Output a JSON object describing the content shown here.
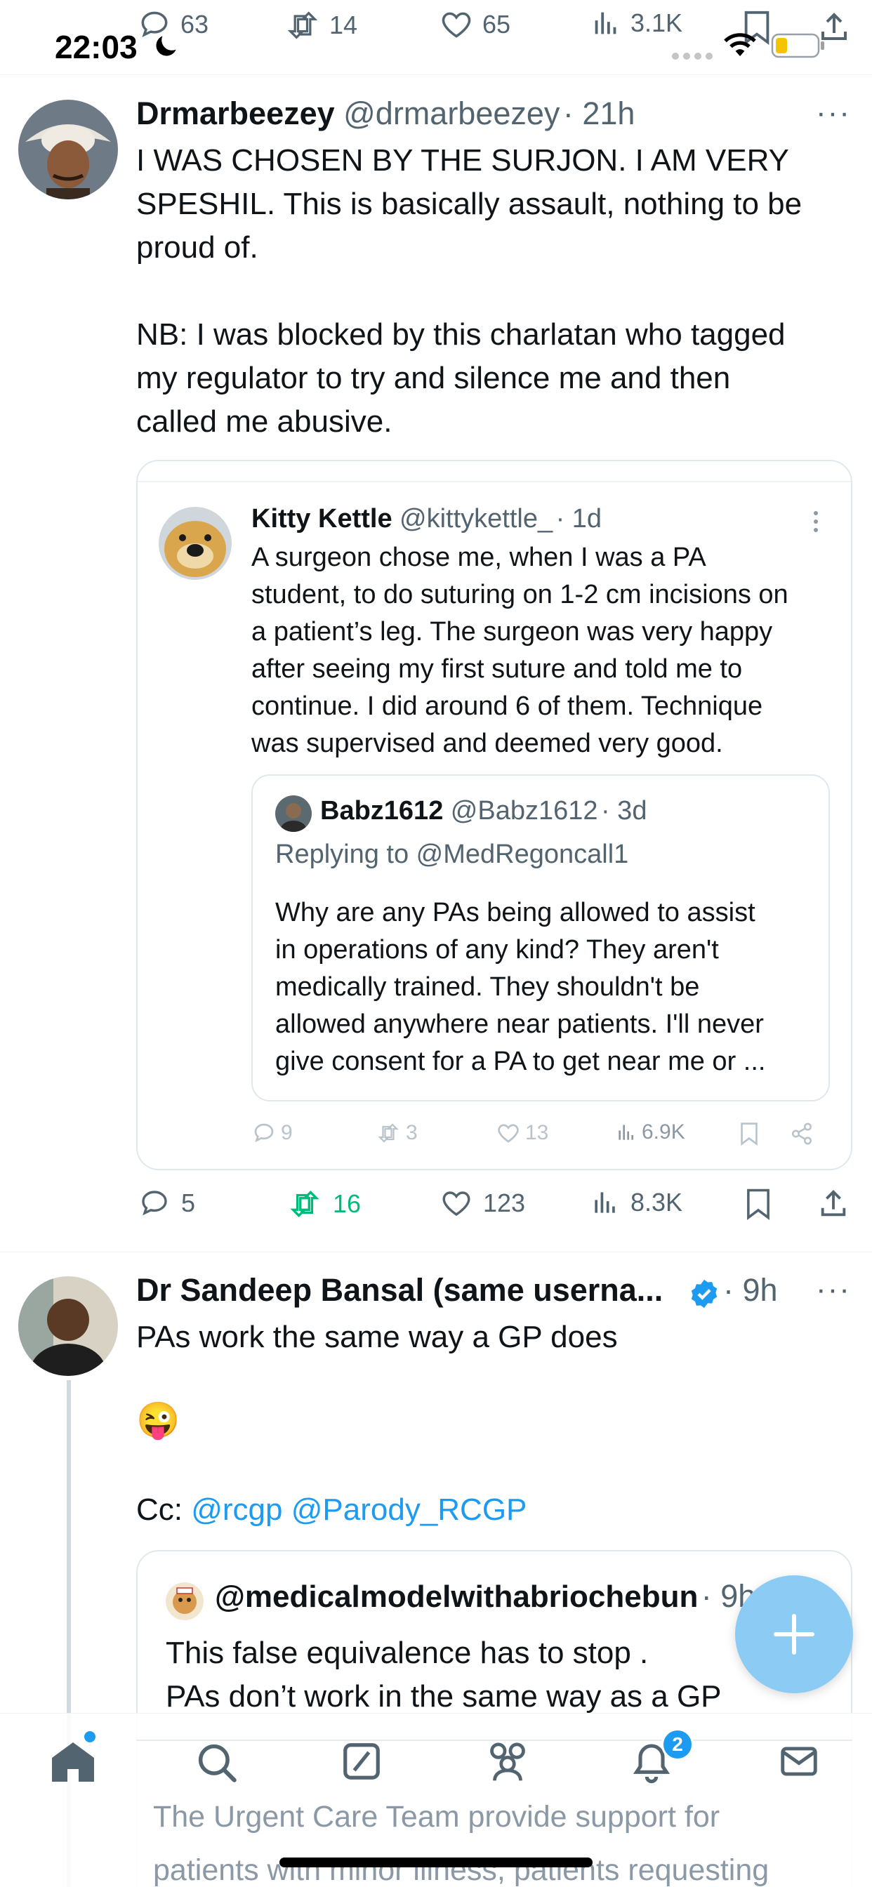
{
  "status_bar": {
    "time": "22:03"
  },
  "top_actions": {
    "replies": "63",
    "reposts": "14",
    "likes": "65",
    "views": "3.1K"
  },
  "tweet1": {
    "display_name": "Drmarbeezey",
    "handle": "@drmarbeezey",
    "time": "· 21h",
    "more": "···",
    "text_lines": [
      "I WAS CHOSEN BY THE SURJON. I AM VERY",
      "SPESHIL. This is basically assault, nothing to be",
      "proud of.",
      "NB: I was blocked by this charlatan who tagged",
      "my regulator to try and silence me and then",
      "called me abusive."
    ],
    "quote": {
      "display_name": "Kitty Kettle",
      "handle": "@kittykettle_",
      "time": "· 1d",
      "text_lines": [
        "A surgeon chose me, when I was a PA",
        "student, to do suturing on 1-2 cm incisions on",
        "a patient’s leg. The surgeon was very happy",
        "after seeing my first suture and told me to",
        "continue. I did around 6 of them. Technique",
        "was supervised and deemed very good."
      ],
      "nested": {
        "display_name": "Babz1612",
        "handle": "@Babz1612",
        "time": "· 3d",
        "replying": "Replying to @MedRegoncall1",
        "text_lines": [
          "Why are any PAs being allowed to assist",
          "in operations of any kind? They aren't",
          "medically trained. They shouldn't be",
          "allowed anywhere near patients. I'll never",
          "give consent for a PA to get near me or ..."
        ]
      },
      "stats": {
        "replies": "9",
        "reposts": "3",
        "likes": "13",
        "views": "6.9K"
      }
    },
    "stats": {
      "replies": "5",
      "reposts": "16",
      "likes": "123",
      "views": "8.3K"
    }
  },
  "tweet2": {
    "display_name": "Dr Sandeep Bansal (same userna...",
    "time": "· 9h",
    "more": "···",
    "line1": "PAs work the same way a GP does",
    "emoji": "😜",
    "cc_label": "Cc: ",
    "mention1": "@rcgp",
    "mention2": "@Parody_RCGP",
    "quote": {
      "handle": "@medicalmodelwithabriochebun",
      "time": "· 9h",
      "line1": "This false equivalence has to stop .",
      "line2": "PAs don’t work in the same way as a GP",
      "peek1": "The Urgent Care Team provide support for",
      "peek2": "patients with minor illness, patients requesting"
    }
  },
  "nav": {
    "notification_count": "2"
  },
  "colors": {
    "accent": "#1d9bf0",
    "repost_active": "#00ba7c",
    "muted": "#536471"
  }
}
